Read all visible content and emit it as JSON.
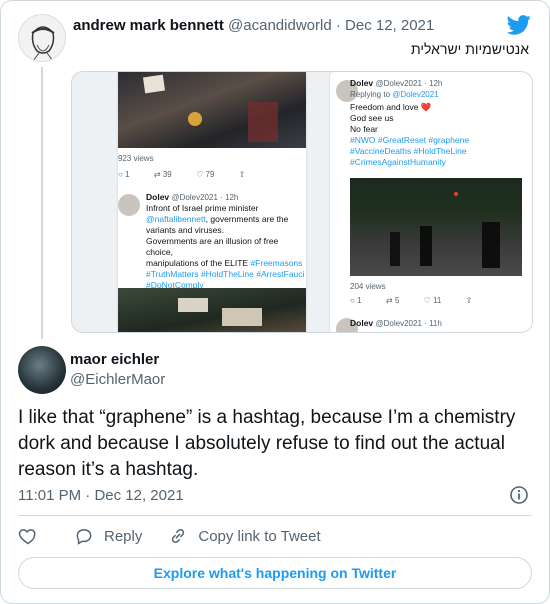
{
  "tweet1": {
    "name": "andrew mark bennett",
    "handle": "@acandidworld",
    "separator": "·",
    "date": "Dec 12, 2021",
    "text": "אנטישמיות ישראלית",
    "embedded": {
      "left_panel": {
        "views": "923 views",
        "counts": {
          "reply": "1",
          "retweet": "39",
          "like": "79"
        },
        "author": "Dolev",
        "handle_time": "@Dolev2021 · 12h",
        "line1": "Infront of Israel prime minister",
        "mention": "@naftalibennett",
        "line2": ", governments are the",
        "line3": "variants and viruses.",
        "line4": "Governments are an illusion of free choice,",
        "line5": "manipulations of the ELITE",
        "tag_freemasons": "#Freemasons",
        "tags_line": "#TruthMatters #HoldTheLine #ArrestFauci",
        "tag_donotcomply": "#DoNotComply"
      },
      "right_panel": {
        "author": "Dolev",
        "handle_time": "@Dolev2021 · 12h",
        "replying_to": "Replying to",
        "replying_handle": "@Dolev2021",
        "line1": "Freedom and love",
        "heart": "❤️",
        "line2": "God see us",
        "line3": "No fear",
        "tags1": "#NWO #GreatReset #graphene",
        "tags2": "#VaccineDeaths #HoldTheLine",
        "tags3": "#CrimesAgainstHumanity",
        "views": "204 views",
        "counts": {
          "reply": "1",
          "retweet": "5",
          "like": "11"
        },
        "author2": "Dolev",
        "handle_time2": "@Dolev2021 · 11h"
      }
    }
  },
  "tweet2": {
    "name": "maor eichler",
    "handle": "@EichlerMaor",
    "text": "I like that “graphene” is a hashtag, because I’m a chemistry dork and because I absolutely refuse to find out the actual reason it’s a hashtag.",
    "time": "11:01 PM",
    "separator": "·",
    "date": "Dec 12, 2021"
  },
  "actions": {
    "reply": "Reply",
    "copy_link": "Copy link to Tweet"
  },
  "explore_label": "Explore what's happening on Twitter",
  "colors": {
    "accent": "#1d9bf0",
    "muted": "#536471",
    "border": "#cfd9de",
    "heart": "#e0245e"
  }
}
